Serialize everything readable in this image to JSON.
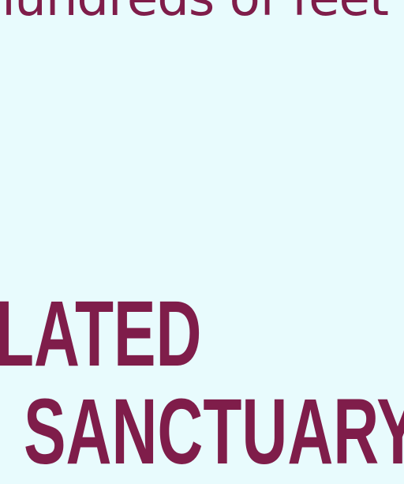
{
  "body_text": "hundreds of feet",
  "headline": {
    "line1": "LATED",
    "line2": "SANCTUARY"
  },
  "colors": {
    "text": "#7f1d4a",
    "background": "#e8fbfd"
  }
}
